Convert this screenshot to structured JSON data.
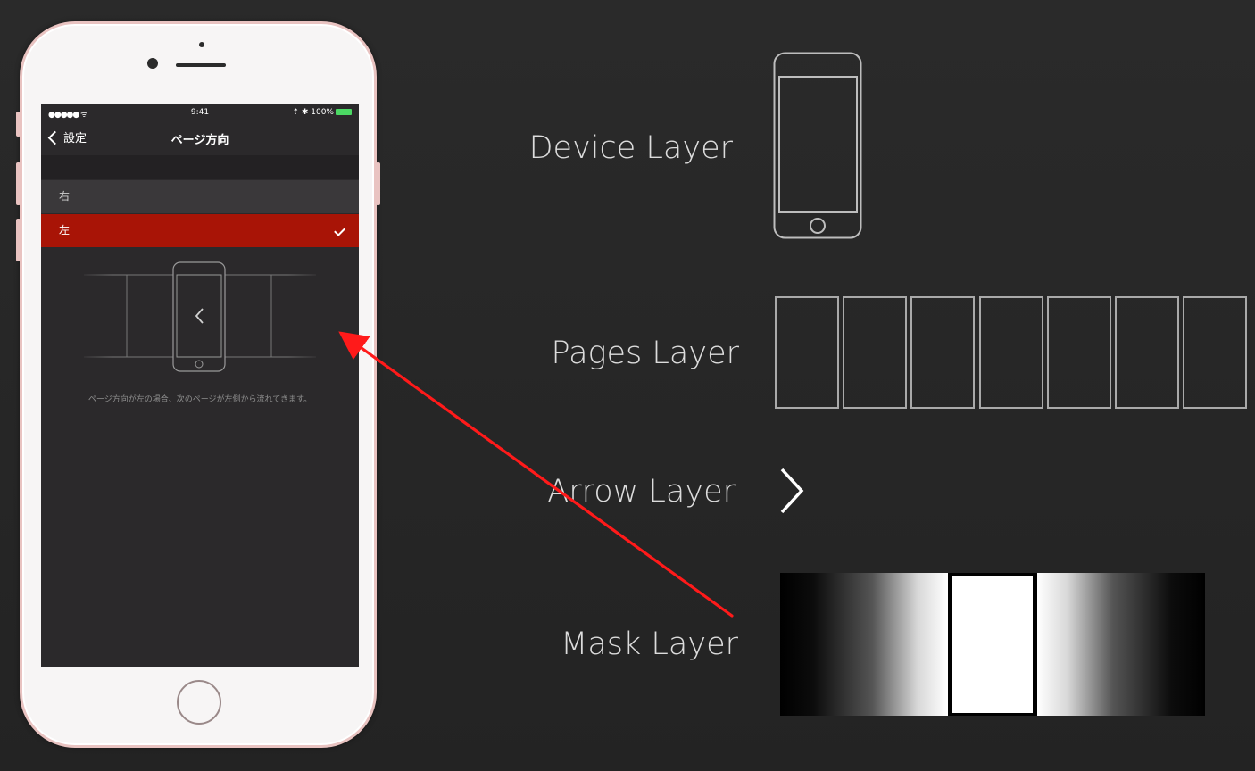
{
  "phone": {
    "status": {
      "signal": "●●●●● ᯤ",
      "time": "9:41",
      "right": "⇡ ✱ 100%"
    },
    "nav": {
      "back_label": "設定",
      "title": "ページ方向"
    },
    "options": [
      {
        "label": "右",
        "selected": false
      },
      {
        "label": "左",
        "selected": true
      }
    ],
    "caption": "ページ方向が左の場合、次のページが左側から流れてきます。"
  },
  "layers": {
    "device": "Device Layer",
    "pages": "Pages Layer",
    "arrow": "Arrow Layer",
    "mask": "Mask Layer"
  },
  "icons": {
    "device": "phone-outline-icon",
    "arrow": "chevron-right-icon",
    "check": "checkmark-icon"
  },
  "colors": {
    "selected_row": "#a81406",
    "annotation_arrow": "#ff1a1a",
    "phone_frame": "#e9c3c1"
  }
}
